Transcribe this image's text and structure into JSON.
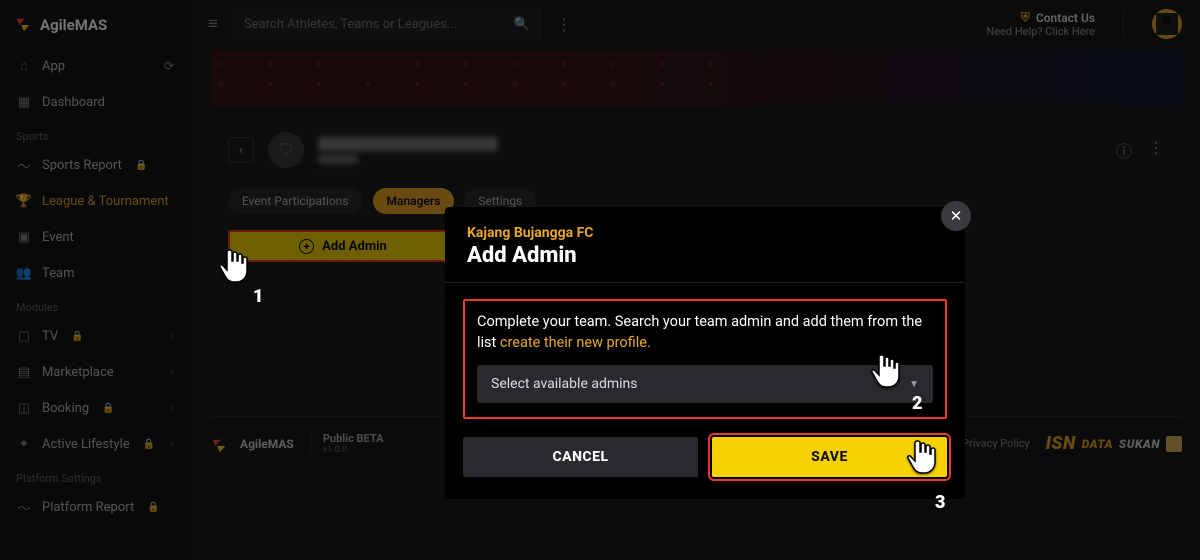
{
  "brand": "AgileMAS",
  "search": {
    "placeholder": "Search Athletes, Teams or Leagues..."
  },
  "topbar": {
    "contact_title": "Contact Us",
    "contact_sub": "Need Help? Click Here"
  },
  "sidebar": {
    "items": [
      {
        "label": "App"
      },
      {
        "label": "Dashboard"
      }
    ],
    "group1": "Sports",
    "g1items": [
      {
        "label": "Sports Report"
      },
      {
        "label": "League & Tournament"
      },
      {
        "label": "Event"
      },
      {
        "label": "Team"
      }
    ],
    "group2": "Modules",
    "g2items": [
      {
        "label": "TV"
      },
      {
        "label": "Marketplace"
      },
      {
        "label": "Booking"
      },
      {
        "label": "Active Lifestyle"
      }
    ],
    "group3": "Platform Settings",
    "g3items": [
      {
        "label": "Platform Report"
      }
    ]
  },
  "page": {
    "tabs": [
      "Event Participations",
      "Managers",
      "Settings"
    ],
    "add_admin": "Add Admin"
  },
  "footer": {
    "brand": "AgileMAS",
    "beta": "Public BETA",
    "ver": "v1.0.0",
    "links": [
      "Privacy Policy"
    ],
    "isn": "ISN",
    "ds1": "DATA",
    "ds2": "SUKAN"
  },
  "modal": {
    "team": "Kajang Bujangga FC",
    "title": "Add Admin",
    "desc_a": "Complete your team. Search your team admin and add them from the list ",
    "desc_link": "create their new profile.",
    "select": "Select available admins",
    "cancel": "CANCEL",
    "save": "SAVE"
  },
  "steps": {
    "s1": "1",
    "s2": "2",
    "s3": "3"
  }
}
